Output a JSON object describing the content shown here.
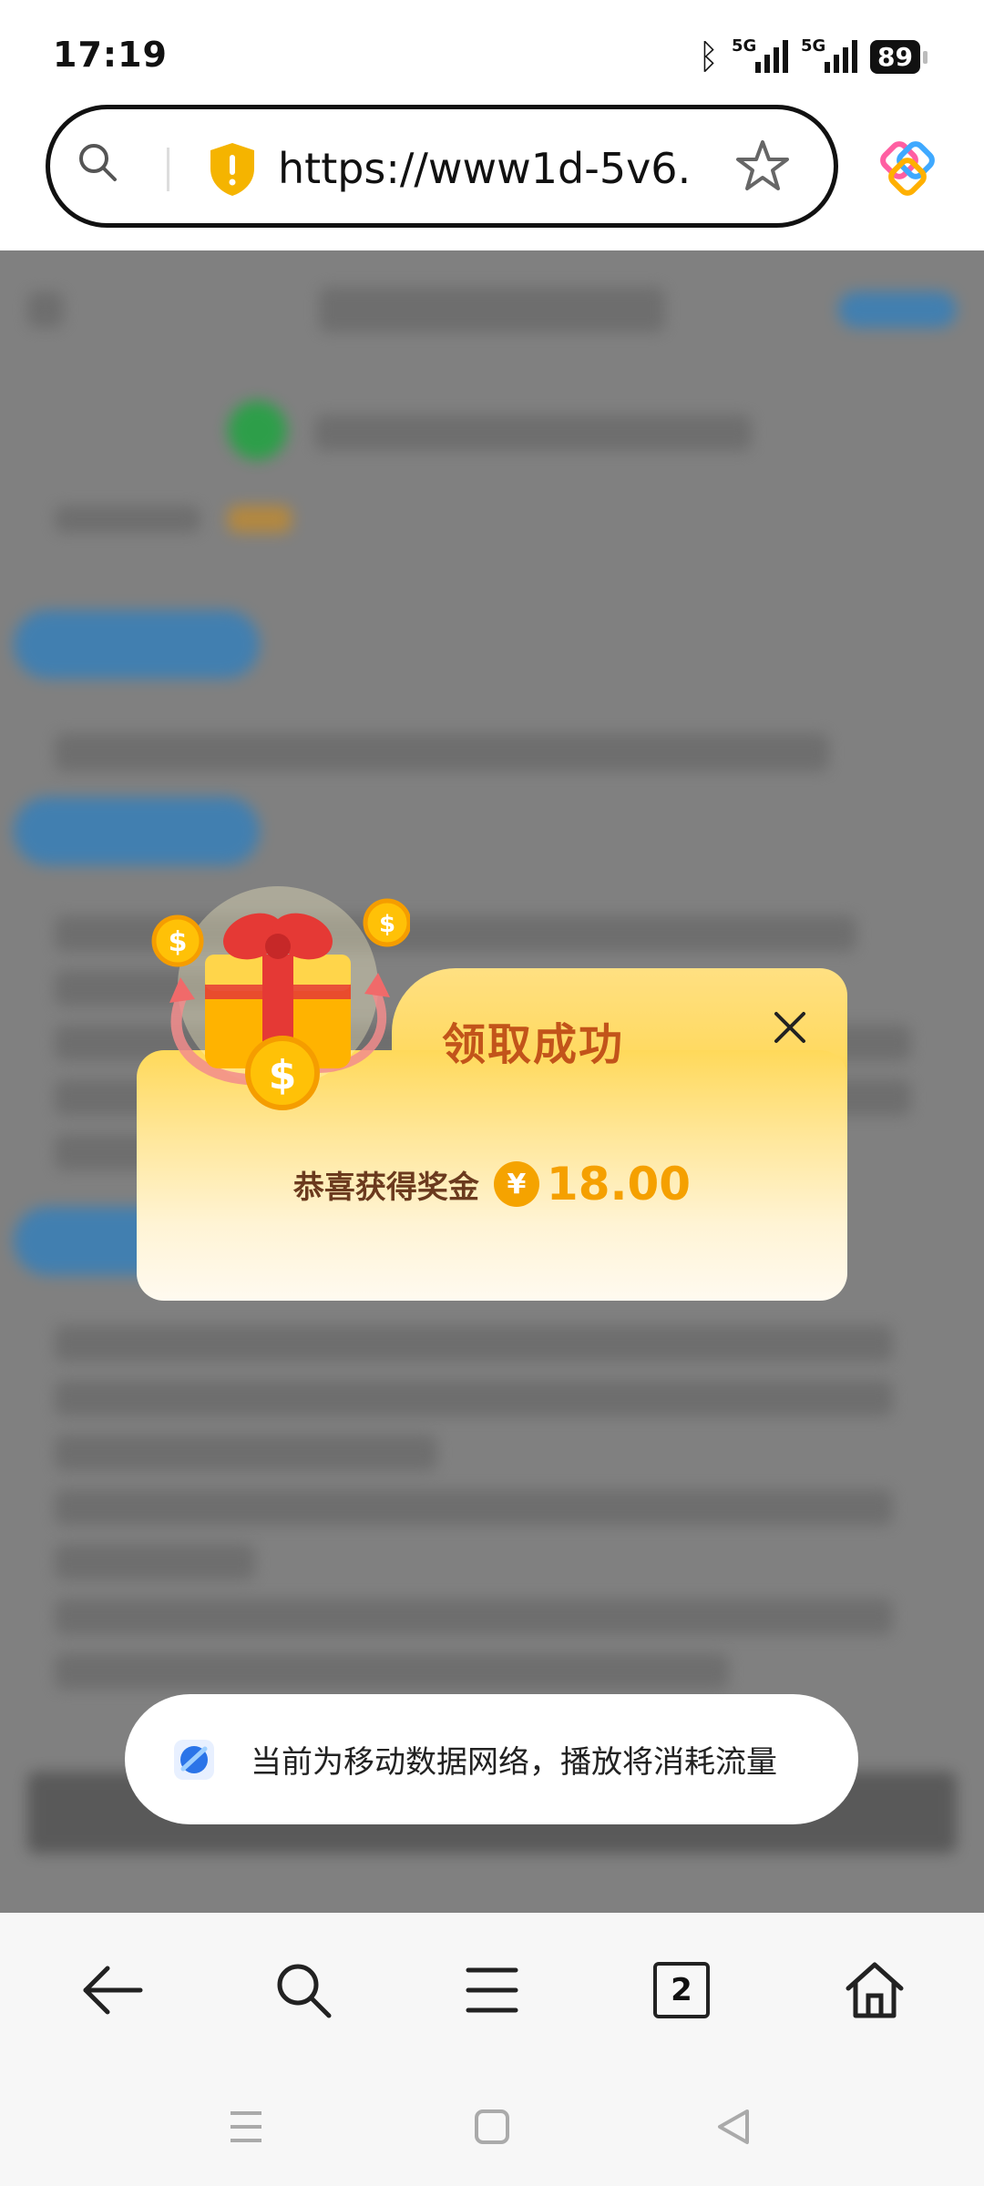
{
  "status_bar": {
    "time": "17:19",
    "network1": "5G",
    "network2": "5G",
    "battery": "89"
  },
  "browser": {
    "url": "https://www1d-5v6...",
    "search_icon": "search-icon",
    "security_icon": "shield-warning-icon",
    "bookmark_icon": "star-icon",
    "app_icon": "browser-logo-icon"
  },
  "reward_dialog": {
    "title": "领取成功",
    "reward_label": "恭喜获得奖金",
    "currency_symbol": "¥",
    "amount": "18.00",
    "accent_color": "#f5a000",
    "title_color": "#c2541a"
  },
  "toast": {
    "text": "当前为移动数据网络，播放将消耗流量"
  },
  "bottom_nav": {
    "tab_count": "2",
    "items": [
      "back-icon",
      "search-icon",
      "menu-icon",
      "tabs-icon",
      "home-icon"
    ]
  },
  "system_nav": [
    "recent-apps-icon",
    "home-button-icon",
    "back-triangle-icon"
  ]
}
